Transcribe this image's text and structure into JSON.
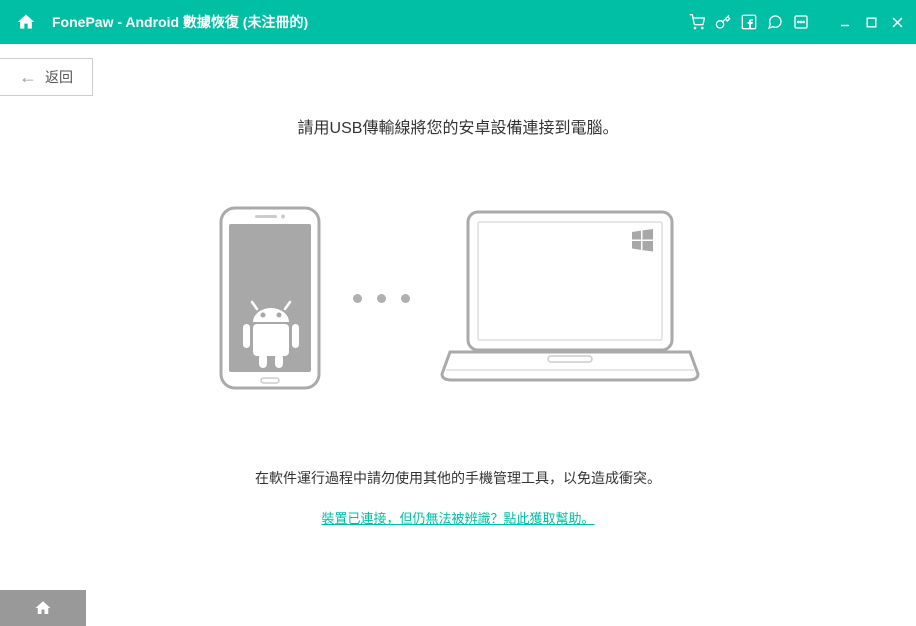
{
  "titlebar": {
    "app_title": "FonePaw - Android 數據恢復 (未注冊的)"
  },
  "back": {
    "label": "返回"
  },
  "main": {
    "instruction": "請用USB傳輸線將您的安卓設備連接到電腦。",
    "warning": "在軟件運行過程中請勿使用其他的手機管理工具，以免造成衝突。",
    "help_link": "裝置已連接，但仍無法被辨識？點此獲取幫助。"
  }
}
